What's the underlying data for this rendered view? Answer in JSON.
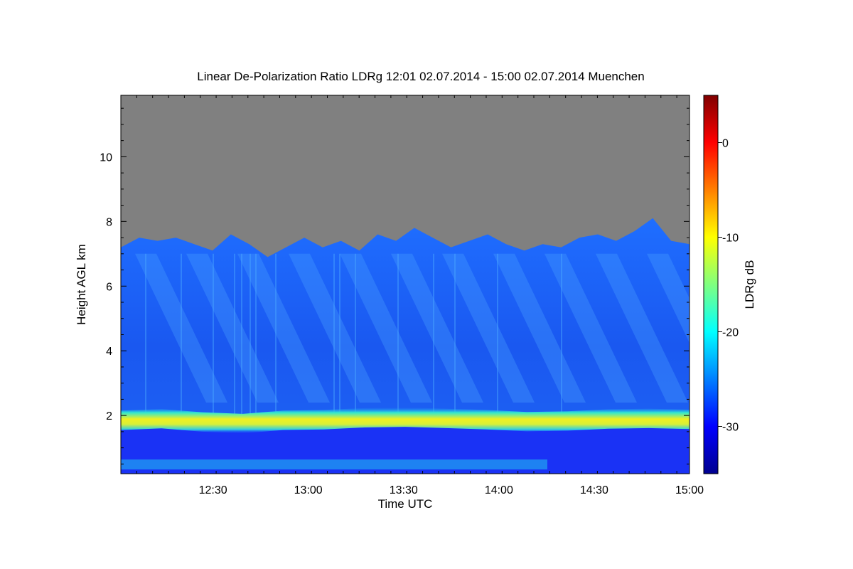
{
  "chart_data": {
    "type": "heatmap",
    "title": "Linear De-Polarization Ratio LDRg   12:01 02.07.2014 - 15:00 02.07.2014 Muenchen",
    "xlabel": "Time UTC",
    "ylabel": "Height AGL km",
    "colorbar_label": "LDRg dB",
    "x_ticks": [
      "12:30",
      "13:00",
      "13:30",
      "14:00",
      "14:30",
      "15:00"
    ],
    "x_range": [
      "12:01",
      "15:00"
    ],
    "y_ticks": [
      2,
      4,
      6,
      8,
      10
    ],
    "y_range": [
      0.2,
      11.9
    ],
    "colorbar_ticks": [
      0,
      -10,
      -20,
      -30
    ],
    "colorbar_range": [
      -35,
      5
    ],
    "colormap": "jet",
    "no_data_color": "#808080",
    "features": {
      "layer_top_km": [
        7.2,
        7.5,
        7.4,
        7.5,
        7.3,
        7.1,
        7.6,
        7.3,
        6.9,
        7.2,
        7.5,
        7.2,
        7.4,
        7.1,
        7.6,
        7.4,
        7.8,
        7.5,
        7.2,
        7.4,
        7.6,
        7.3,
        7.1,
        7.3,
        7.2,
        7.5,
        7.6,
        7.4,
        7.7,
        8.1,
        7.4,
        7.3
      ],
      "boundary_layer_band_km": 1.85,
      "boundary_layer_band_ldr_db": -10,
      "background_ldr_db": -29
    }
  }
}
